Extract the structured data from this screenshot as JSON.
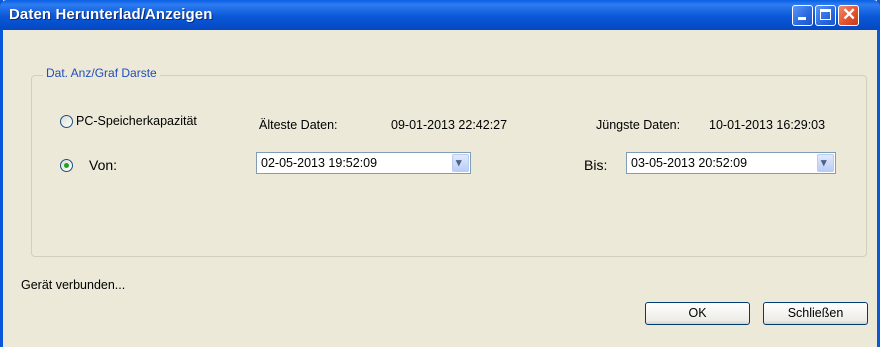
{
  "window": {
    "title": "Daten Herunterlad/Anzeigen"
  },
  "group": {
    "label": "Dat. Anz/Graf Darste"
  },
  "option_pc": {
    "label": "PC-Speicherkapazität",
    "selected": false
  },
  "oldest": {
    "label": "Älteste Daten:",
    "value": "09-01-2013 22:42:27"
  },
  "newest": {
    "label": "Jüngste Daten:",
    "value": "10-01-2013 16:29:03"
  },
  "option_von": {
    "label": "Von:",
    "selected": true
  },
  "von_select": {
    "value": "02-05-2013 19:52:09"
  },
  "bis": {
    "label": "Bis:",
    "value": "03-05-2013 20:52:09"
  },
  "status": {
    "text": "Gerät verbunden..."
  },
  "buttons": {
    "ok": "OK",
    "close": "Schließen"
  },
  "colors": {
    "title_bar": "#0a58d8",
    "window_bg": "#ece9d8",
    "group_label": "#1f4dbb",
    "radio_dot": "#21a121"
  }
}
